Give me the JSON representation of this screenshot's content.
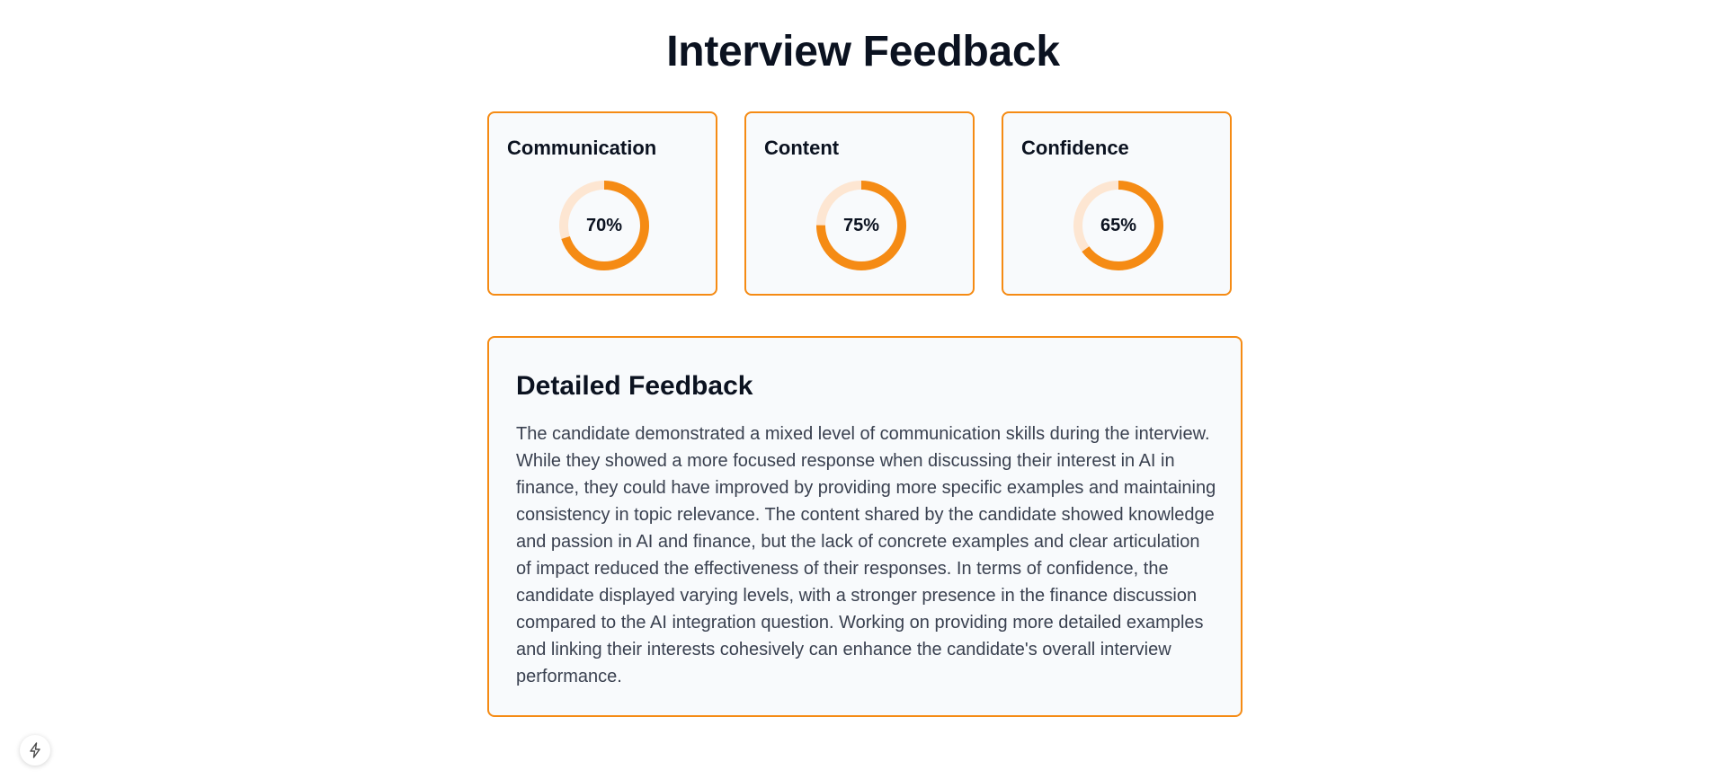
{
  "page": {
    "title": "Interview Feedback"
  },
  "accent_color": "#f58b14",
  "track_color": "#fde6d2",
  "scores": [
    {
      "label": "Communication",
      "value": 70,
      "display": "70%"
    },
    {
      "label": "Content",
      "value": 75,
      "display": "75%"
    },
    {
      "label": "Confidence",
      "value": 65,
      "display": "65%"
    }
  ],
  "detailed_feedback": {
    "title": "Detailed Feedback",
    "body": "The candidate demonstrated a mixed level of communication skills during the interview. While they showed a more focused response when discussing their interest in AI in finance, they could have improved by providing more specific examples and maintaining consistency in topic relevance. The content shared by the candidate showed knowledge and passion in AI and finance, but the lack of concrete examples and clear articulation of impact reduced the effectiveness of their responses. In terms of confidence, the candidate displayed varying levels, with a stronger presence in the finance discussion compared to the AI integration question. Working on providing more detailed examples and linking their interests cohesively can enhance the candidate's overall interview performance."
  },
  "corner_button": {
    "icon": "lightning-bolt-icon"
  }
}
